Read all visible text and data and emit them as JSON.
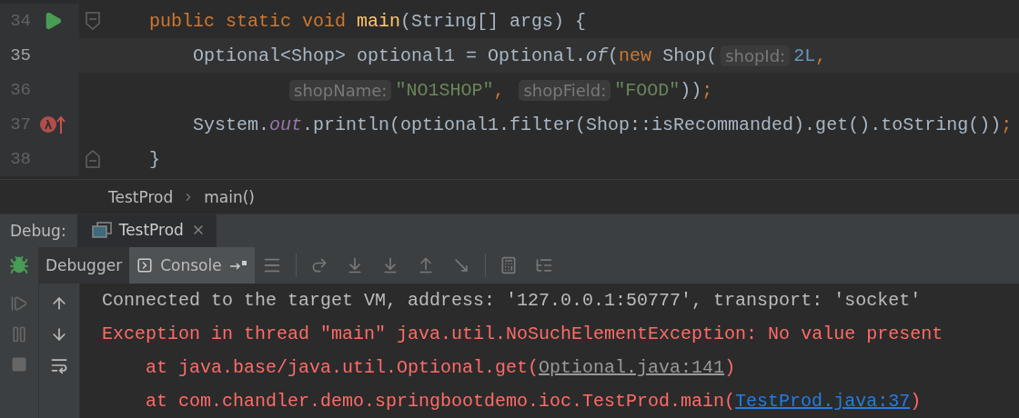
{
  "editor": {
    "lines": [
      {
        "number": "34",
        "current": false,
        "kind": "member",
        "run_marker": true,
        "lambda_breakpoint": false,
        "fold_start": true,
        "fold_end": false,
        "tokens": [
          {
            "kind": "keyword",
            "text": "public static void "
          },
          {
            "kind": "declaration",
            "text": "main"
          },
          {
            "kind": "plain",
            "text": "(String[] args) {"
          }
        ]
      },
      {
        "number": "35",
        "current": true,
        "kind": "statement",
        "run_marker": false,
        "lambda_breakpoint": false,
        "fold_start": false,
        "fold_end": false,
        "tokens": [
          {
            "kind": "plain",
            "text": "Optional<Shop> optional1 = Optional."
          },
          {
            "kind": "static-method",
            "text": "of"
          },
          {
            "kind": "plain",
            "text": "("
          },
          {
            "kind": "keyword",
            "text": "new "
          },
          {
            "kind": "plain",
            "text": "Shop("
          },
          {
            "kind": "hint",
            "text": "shopId:"
          },
          {
            "kind": "number",
            "text": "2L"
          },
          {
            "kind": "keyword",
            "text": ","
          }
        ]
      },
      {
        "number": "36",
        "current": false,
        "kind": "continuation",
        "run_marker": false,
        "lambda_breakpoint": false,
        "fold_start": false,
        "fold_end": false,
        "tokens": [
          {
            "kind": "hint",
            "text": "shopName:"
          },
          {
            "kind": "string",
            "text": "\"NO1SHOP\""
          },
          {
            "kind": "keyword",
            "text": ", "
          },
          {
            "kind": "hint",
            "text": "shopField:"
          },
          {
            "kind": "string",
            "text": "\"FOOD\""
          },
          {
            "kind": "plain",
            "text": "))"
          },
          {
            "kind": "keyword",
            "text": ";"
          }
        ]
      },
      {
        "number": "37",
        "current": false,
        "kind": "statement",
        "run_marker": false,
        "lambda_breakpoint": true,
        "fold_start": false,
        "fold_end": false,
        "tokens": [
          {
            "kind": "plain",
            "text": "System."
          },
          {
            "kind": "static-field",
            "text": "out"
          },
          {
            "kind": "plain",
            "text": ".println(optional1.filter(Shop::isRecommanded).get().toString())"
          },
          {
            "kind": "keyword",
            "text": ";"
          }
        ]
      },
      {
        "number": "38",
        "current": false,
        "kind": "member",
        "run_marker": false,
        "lambda_breakpoint": false,
        "fold_start": false,
        "fold_end": true,
        "tokens": [
          {
            "kind": "plain",
            "text": "}"
          }
        ]
      }
    ]
  },
  "breadcrumbs": [
    "TestProd",
    "main()"
  ],
  "debug_panel": {
    "label": "Debug:",
    "tabs": [
      {
        "label": "TestProd",
        "selected": true
      }
    ],
    "view_tabs": [
      {
        "label": "Debugger",
        "selected": false
      },
      {
        "label": "Console",
        "selected": true
      }
    ]
  },
  "console": {
    "lines": [
      {
        "kind": "info",
        "segments": [
          {
            "kind": "text",
            "text": "Connected to the target VM, address: '127.0.0.1:50777', transport: 'socket'"
          }
        ]
      },
      {
        "kind": "error",
        "segments": [
          {
            "kind": "text",
            "text": "Exception in thread \"main\" java.util.NoSuchElementException: No value present"
          }
        ]
      },
      {
        "kind": "trace",
        "segments": [
          {
            "kind": "text",
            "text": "at java.base/java.util.Optional.get("
          },
          {
            "kind": "library-link",
            "text": "Optional.java:141"
          },
          {
            "kind": "text",
            "text": ")"
          }
        ]
      },
      {
        "kind": "trace",
        "segments": [
          {
            "kind": "text",
            "text": "at com.chandler.demo.springbootdemo.ioc.TestProd.main("
          },
          {
            "kind": "source-link",
            "text": "TestProd.java:37"
          },
          {
            "kind": "text",
            "text": ")"
          }
        ]
      }
    ]
  }
}
